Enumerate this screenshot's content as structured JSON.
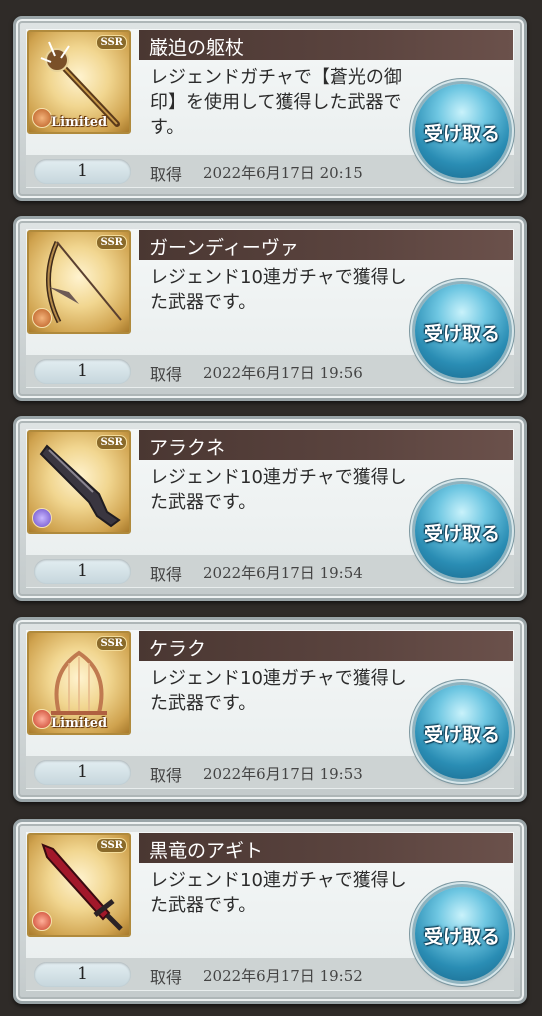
{
  "items": [
    {
      "name": "巌迫の躯杖",
      "description": "レジェンドガチャで【蒼光の御印】を使用して獲得した武器です。",
      "rarity": "SSR",
      "limited_label": "Limited",
      "element_color": "#b85a20",
      "quantity": "1",
      "acquired_label": "取得",
      "acquired_date": "2022年6月17日 20:15",
      "button_label": "受け取る",
      "weapon_icon": "staff-icon"
    },
    {
      "name": "ガーンディーヴァ",
      "description": "レジェンド10連ガチャで獲得した武器です。",
      "rarity": "SSR",
      "limited_label": "",
      "element_color": "#b85a20",
      "quantity": "1",
      "acquired_label": "取得",
      "acquired_date": "2022年6月17日 19:56",
      "button_label": "受け取る",
      "weapon_icon": "bow-icon"
    },
    {
      "name": "アラクネ",
      "description": "レジェンド10連ガチャで獲得した武器です。",
      "rarity": "SSR",
      "limited_label": "",
      "element_color": "#6a4cc8",
      "quantity": "1",
      "acquired_label": "取得",
      "acquired_date": "2022年6月17日 19:54",
      "button_label": "受け取る",
      "weapon_icon": "gun-icon"
    },
    {
      "name": "ケラク",
      "description": "レジェンド10連ガチャで獲得した武器です。",
      "rarity": "SSR",
      "limited_label": "Limited",
      "element_color": "#c8402a",
      "quantity": "1",
      "acquired_label": "取得",
      "acquired_date": "2022年6月17日 19:53",
      "button_label": "受け取る",
      "weapon_icon": "harp-icon"
    },
    {
      "name": "黒竜のアギト",
      "description": "レジェンド10連ガチャで獲得した武器です。",
      "rarity": "SSR",
      "limited_label": "",
      "element_color": "#c8402a",
      "quantity": "1",
      "acquired_label": "取得",
      "acquired_date": "2022年6月17日 19:52",
      "button_label": "受け取る",
      "weapon_icon": "sword-icon"
    }
  ]
}
